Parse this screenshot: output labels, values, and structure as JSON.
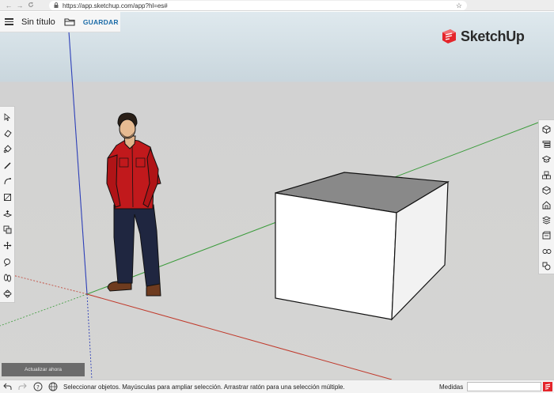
{
  "browser": {
    "back_glyph": "←",
    "forward_glyph": "→",
    "reload_glyph": "C",
    "url": "https://app.sketchup.com/app?hl=es#",
    "lock_icon": "lock-icon",
    "star_glyph": "☆"
  },
  "app": {
    "document_title": "Sin título",
    "save_label": "GUARDAR",
    "logo_text": "SketchUp",
    "brand_color": "#e4252b",
    "accent_color": "#1c6ca8"
  },
  "left_toolbar": {
    "tools": [
      "select-icon",
      "eraser-icon",
      "paint-bucket-icon",
      "pencil-icon",
      "arc-icon",
      "rectangle-icon",
      "push-pull-icon",
      "offset-icon",
      "move-icon",
      "tape-measure-icon",
      "walk-icon",
      "orbit-icon"
    ]
  },
  "right_toolbar": {
    "tools": [
      "entity-info-icon",
      "outliner-icon",
      "instructor-icon",
      "components-icon",
      "materials-icon",
      "styles-icon",
      "layers-icon",
      "scenes-icon",
      "display-icon",
      "solid-tools-icon"
    ]
  },
  "update_button": {
    "label": "Actualizar ahora"
  },
  "status": {
    "message": "Seleccionar objetos. Mayúsculas para ampliar selección. Arrastrar ratón para una selección múltiple.",
    "measures_label": "Medidas",
    "measures_value": ""
  },
  "axes_colors": {
    "x": "#c0392b",
    "y": "#3a9b3a",
    "z": "#2d3fb8"
  }
}
